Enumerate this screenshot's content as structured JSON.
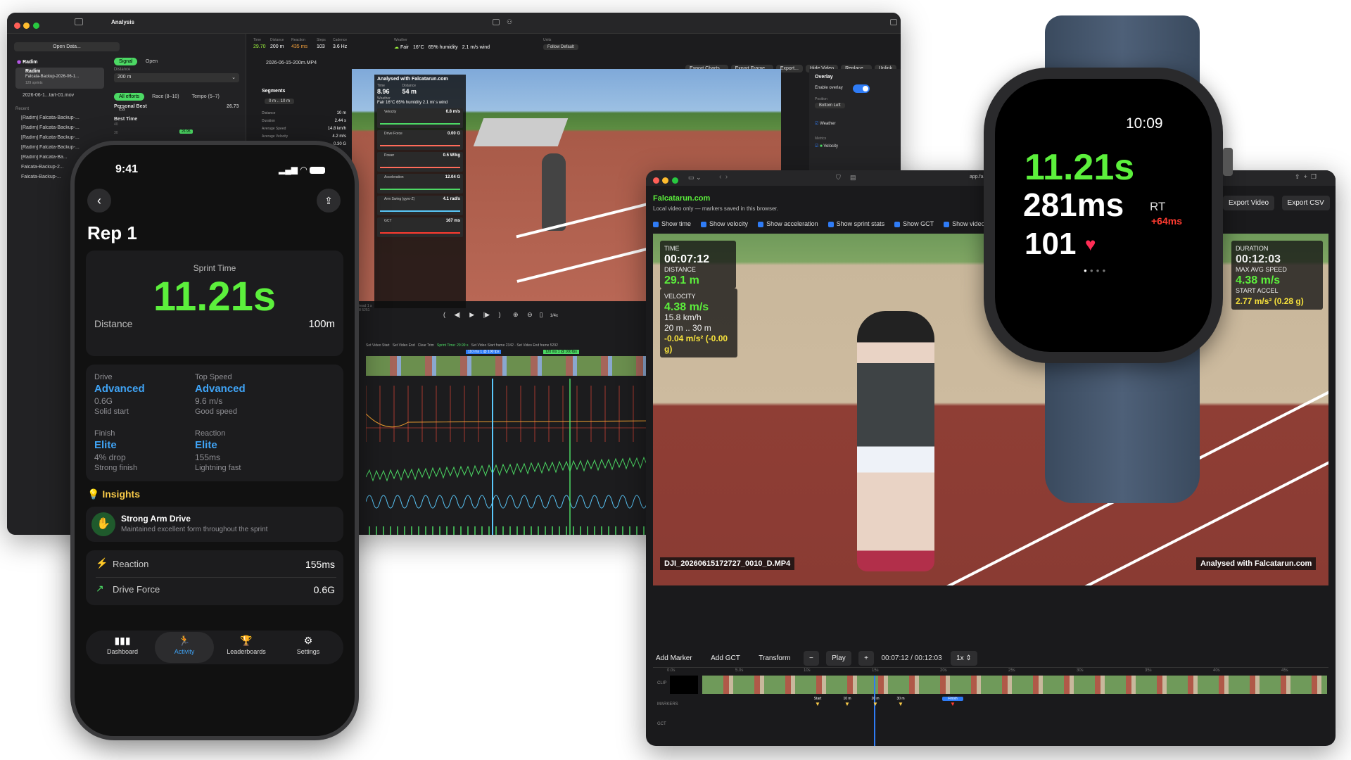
{
  "mac": {
    "title": "Analysis",
    "sidebar": {
      "open_data": "Open Data...",
      "group": "Radim",
      "selected_item": "Radim",
      "selected_sub": "Falcata-Backup-2026-06-1...",
      "selected_meta": "129 sprints",
      "file_item": "2026-06-1...tart-01.mov",
      "recent_label": "Recent",
      "recent_items": [
        "[Radim] Falcata-Backup-...",
        "[Radim] Falcata-Backup-...",
        "[Radim] Falcata-Backup-...",
        "[Radim] Falcata-Backup-...",
        "[Radim] Falcata-Ba...",
        "Falcata-Backup-2...",
        "Falcata-Backup-..."
      ],
      "seg_signal": "Signal",
      "seg_open": "Open",
      "distance_label": "Distance",
      "distance_value": "200 m",
      "filters": [
        "All efforts",
        "Race (8–10)",
        "Tempo (5–7)",
        "Ea"
      ],
      "personal_best_label": "Personal Best",
      "personal_best_value": "26.73",
      "best_time_label": "Best Time",
      "best_time_axis": [
        "40",
        "30"
      ],
      "best_time_badge": "26.95"
    },
    "stats_bar": [
      {
        "label": "Time",
        "value": "29.70"
      },
      {
        "label": "Distance",
        "value": "200 m"
      },
      {
        "label": "Reaction",
        "value": "435 ms"
      },
      {
        "label": "Steps",
        "value": "103"
      },
      {
        "label": "Cadence",
        "value": "3.6 Hz"
      }
    ],
    "weather_label": "Weather",
    "weather": [
      "Fair",
      "16°C",
      "65% humidity",
      "2.1 m/s wind"
    ],
    "units_label": "Units",
    "units_value": "Follow Default",
    "toolbar": [
      "Export Charts...",
      "Export Frame...",
      "Export...",
      "Hide Video",
      "Replace...",
      "Unlink"
    ],
    "file": "2026-06-15-200m.MP4",
    "segments_label": "Segments",
    "segments_range": "0 m .. 10 m",
    "seg_stats": [
      {
        "label": "Distance",
        "value": "10 m"
      },
      {
        "label": "Duration",
        "value": "2.44 s"
      },
      {
        "label": "Average Speed",
        "value": "14.8 km/h"
      },
      {
        "label": "Average Velocity",
        "value": "4.2 m/s"
      },
      {
        "label": "Average Grms",
        "value": "0.30 G"
      }
    ],
    "video_overlay": {
      "header": "Analysed with Falcatarun.com",
      "time_label": "Time",
      "time_value": "8.96",
      "dist_label": "Distance",
      "dist_value": "54 m",
      "weather_label": "Weather",
      "weather_value": "Fair 16°C 65% humidity 2.1 m/ s wind",
      "metrics": [
        {
          "name": "Velocity",
          "value": "6.8 m/s"
        },
        {
          "name": "Drive Force",
          "value": "0.00 G"
        },
        {
          "name": "Power",
          "value": "0.5 W/kg"
        },
        {
          "name": "Acceleration",
          "value": "12.04 G"
        },
        {
          "name": "Arm Swing (gyro-Z)",
          "value": "4.1 rad/s"
        },
        {
          "name": "GCT",
          "value": "167 ms"
        }
      ]
    },
    "overlay_panel": {
      "title": "Overlay",
      "enable_label": "Enable overlay",
      "position_label": "Position",
      "position_value": "Bottom Left",
      "weather_check": "Weather",
      "metrics_label": "Metrics",
      "velocity_check": "Velocity"
    },
    "timeline": {
      "left_text": "Ahead 1 s",
      "left_sub": "1.8 5251",
      "speed": "1/4x",
      "labels": [
        "Set Video Start",
        "Set Video End",
        "Clear Trim"
      ],
      "sprint_label": "Sprint Time: 29.99 s",
      "set_start_frame": "Set Video Start frame 2342",
      "set_end_frame": "Set Video End frame 5292",
      "marker1": "110 ms 1 @ 100 fps",
      "marker2": "120 ms 1 @ 100 fps"
    }
  },
  "ipad": {
    "url": "app.falc",
    "brand": "Falcatarun.com",
    "note": "Local video only — markers saved in this browser.",
    "checks": [
      "Show time",
      "Show velocity",
      "Show acceleration",
      "Show sprint stats",
      "Show GCT",
      "Show video name"
    ],
    "export_video": "Export Video",
    "export_csv": "Export CSV",
    "ov_time_label": "TIME",
    "ov_time_value": "00:07:12",
    "ov_dist_label": "DISTANCE",
    "ov_dist_value": "29.1 m",
    "ov_vel_label": "VELOCITY",
    "ov_vel_value": "4.38 m/s",
    "ov_vel_kmh": "15.8 km/h",
    "ov_vel_range": "20 m .. 30 m",
    "ov_vel_acc": "-0.04 m/s² (-0.00 g)",
    "ov_dur_label": "DURATION",
    "ov_dur_value": "00:12:03",
    "ov_max_label": "MAX AVG SPEED",
    "ov_max_value": "4.38 m/s",
    "ov_start_label": "START ACCEL",
    "ov_start_value": "2.77 m/s² (0.28 g)",
    "filename": "DJI_20260615172727_0010_D.MP4",
    "watermark": "Analysed with Falcatarun.com",
    "controls": {
      "add_marker": "Add Marker",
      "add_gct": "Add GCT",
      "transform": "Transform",
      "minus": "−",
      "play": "Play",
      "plus": "+",
      "timecode": "00:07:12 / 00:12:03",
      "speed": "1x"
    },
    "ruler": [
      "0.0s",
      "5.0s",
      "10s",
      "15s",
      "20s",
      "25s",
      "30s",
      "35s",
      "40s",
      "45s"
    ],
    "track_labels": [
      "CLIP",
      "MARKERS",
      "GCT"
    ],
    "markers": [
      "Start",
      "10 m",
      "20 m",
      "30 m",
      "Finish"
    ]
  },
  "watch": {
    "time": "10:09",
    "sprint": "11.21s",
    "reaction": "281ms",
    "rt_label": "RT",
    "delta": "+64ms",
    "steps": "101"
  },
  "phone": {
    "status_time": "9:41",
    "title": "Rep 1",
    "sprint_label": "Sprint Time",
    "sprint_value": "11.21s",
    "distance_label": "Distance",
    "distance_value": "100m",
    "grid": [
      {
        "label": "Drive",
        "level": "Advanced",
        "value": "0.6G",
        "note": "Solid start"
      },
      {
        "label": "Top Speed",
        "level": "Advanced",
        "value": "9.6 m/s",
        "note": "Good speed"
      },
      {
        "label": "Finish",
        "level": "Elite",
        "value": "4% drop",
        "note": "Strong finish"
      },
      {
        "label": "Reaction",
        "level": "Elite",
        "value": "155ms",
        "note": "Lightning fast"
      }
    ],
    "insights_label": "Insights",
    "insight_title": "Strong Arm Drive",
    "insight_desc": "Maintained excellent form throughout the sprint",
    "rows": [
      {
        "label": "Reaction",
        "value": "155ms"
      },
      {
        "label": "Drive Force",
        "value": "0.6G"
      }
    ],
    "tabs": [
      "Dashboard",
      "Activity",
      "Leaderboards",
      "Settings"
    ]
  },
  "colors": {
    "accent_green": "#4cd964",
    "lime": "#9bf23c",
    "blue": "#3fa3f5",
    "yellow": "#f7e23c",
    "red": "#ff3b30"
  }
}
